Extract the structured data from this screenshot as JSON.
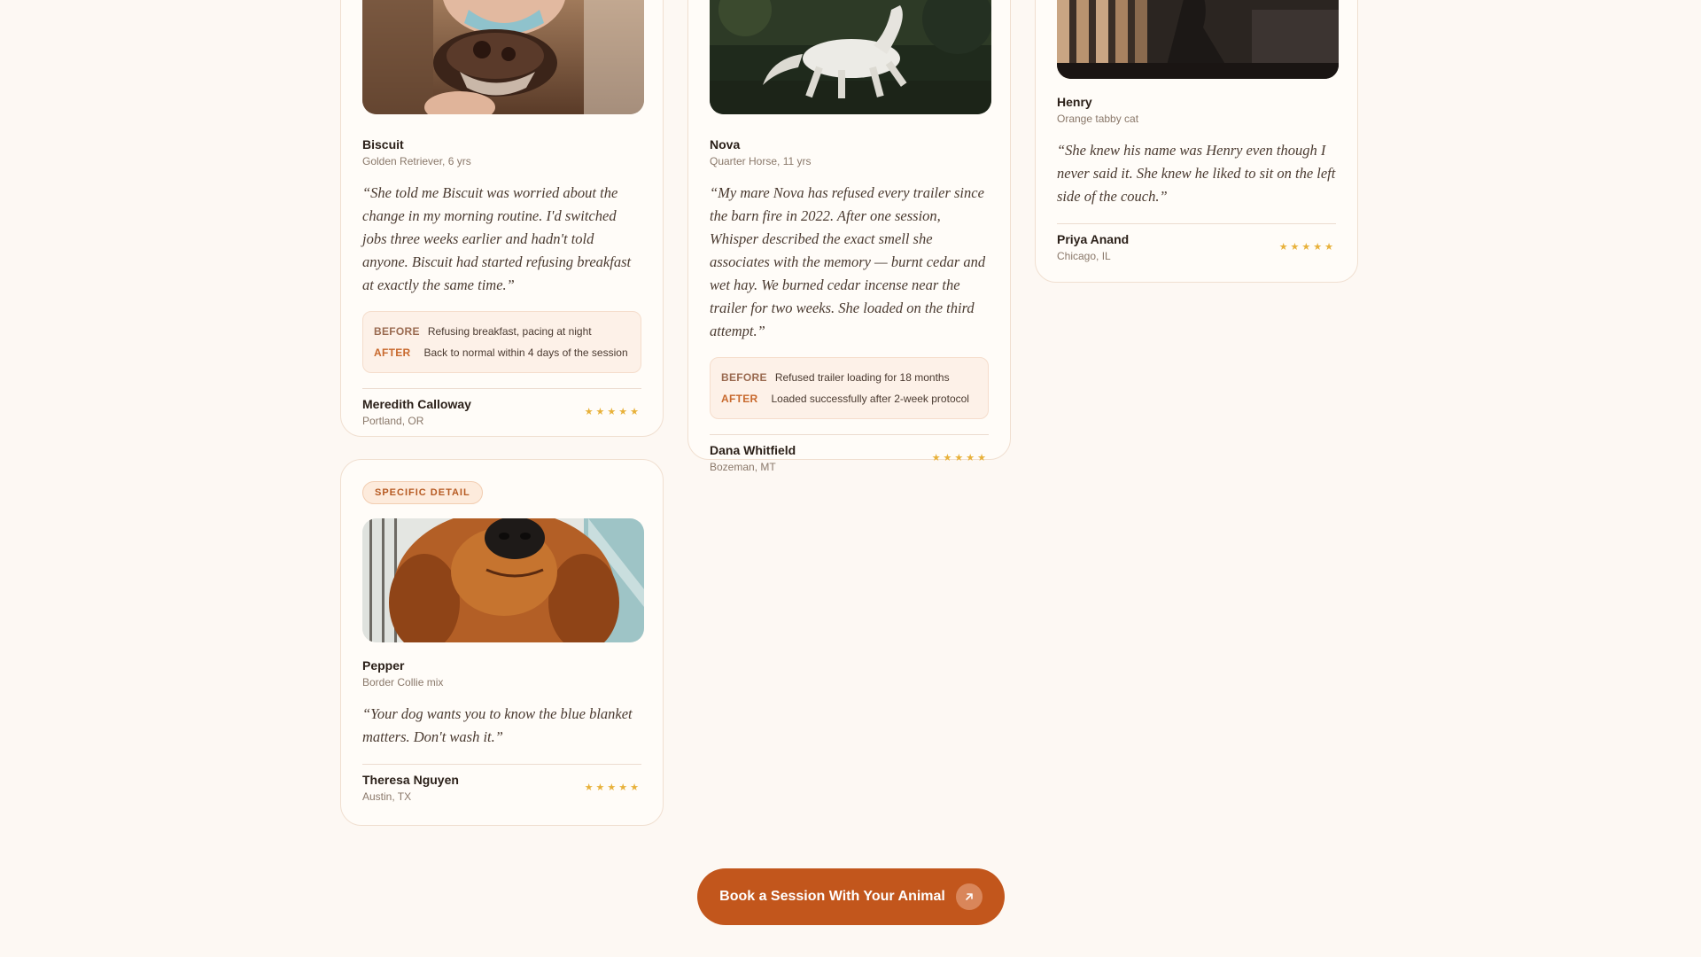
{
  "cards": {
    "biscuit": {
      "pet_name": "Biscuit",
      "pet_sub": "Golden Retriever, 6 yrs",
      "quote": "“She told me Biscuit was worried about the change in my morning routine. I'd switched jobs three weeks earlier and hadn't told anyone. Biscuit had started refusing breakfast at exactly the same time.”",
      "before_label": "BEFORE",
      "before_text": "Refusing breakfast, pacing at night",
      "after_label": "AFTER",
      "after_text": "Back to normal within 4 days of the session",
      "author": "Meredith Calloway",
      "location": "Portland, OR",
      "rating": 5,
      "stars": "★★★★★",
      "photo_icon": "dog-cupcake-photo"
    },
    "nova": {
      "pet_name": "Nova",
      "pet_sub": "Quarter Horse, 11 yrs",
      "quote": "“My mare Nova has refused every trailer since the barn fire in 2022. After one session, Whisper described the exact smell she associates with the memory — burnt cedar and wet hay. We burned cedar incense near the trailer for two weeks. She loaded on the third attempt.”",
      "before_label": "BEFORE",
      "before_text": "Refused trailer loading for 18 months",
      "after_label": "AFTER",
      "after_text": "Loaded successfully after 2-week protocol",
      "author": "Dana Whitfield",
      "location": "Bozeman, MT",
      "rating": 5,
      "stars": "★★★★★",
      "photo_icon": "white-horse-photo"
    },
    "henry": {
      "pet_name": "Henry",
      "pet_sub": "Orange tabby cat",
      "quote": "“She knew his name was Henry even though I never said it. She knew he liked to sit on the left side of the couch.”",
      "author": "Priya Anand",
      "location": "Chicago, IL",
      "rating": 5,
      "stars": "★★★★★",
      "photo_icon": "person-on-couch-photo"
    },
    "pepper": {
      "badge": "SPECIFIC DETAIL",
      "pet_name": "Pepper",
      "pet_sub": "Border Collie mix",
      "quote": "“Your dog wants you to know the blue blanket matters. Don't wash it.”",
      "author": "Theresa Nguyen",
      "location": "Austin, TX",
      "rating": 5,
      "stars": "★★★★★",
      "photo_icon": "golden-dog-closeup-photo"
    }
  },
  "cta": {
    "label": "Book a Session With Your Animal",
    "icon": "arrow-up-right-icon"
  },
  "colors": {
    "background": "#fdf8f3",
    "accent": "#c2561c",
    "star": "#e8b13a"
  }
}
